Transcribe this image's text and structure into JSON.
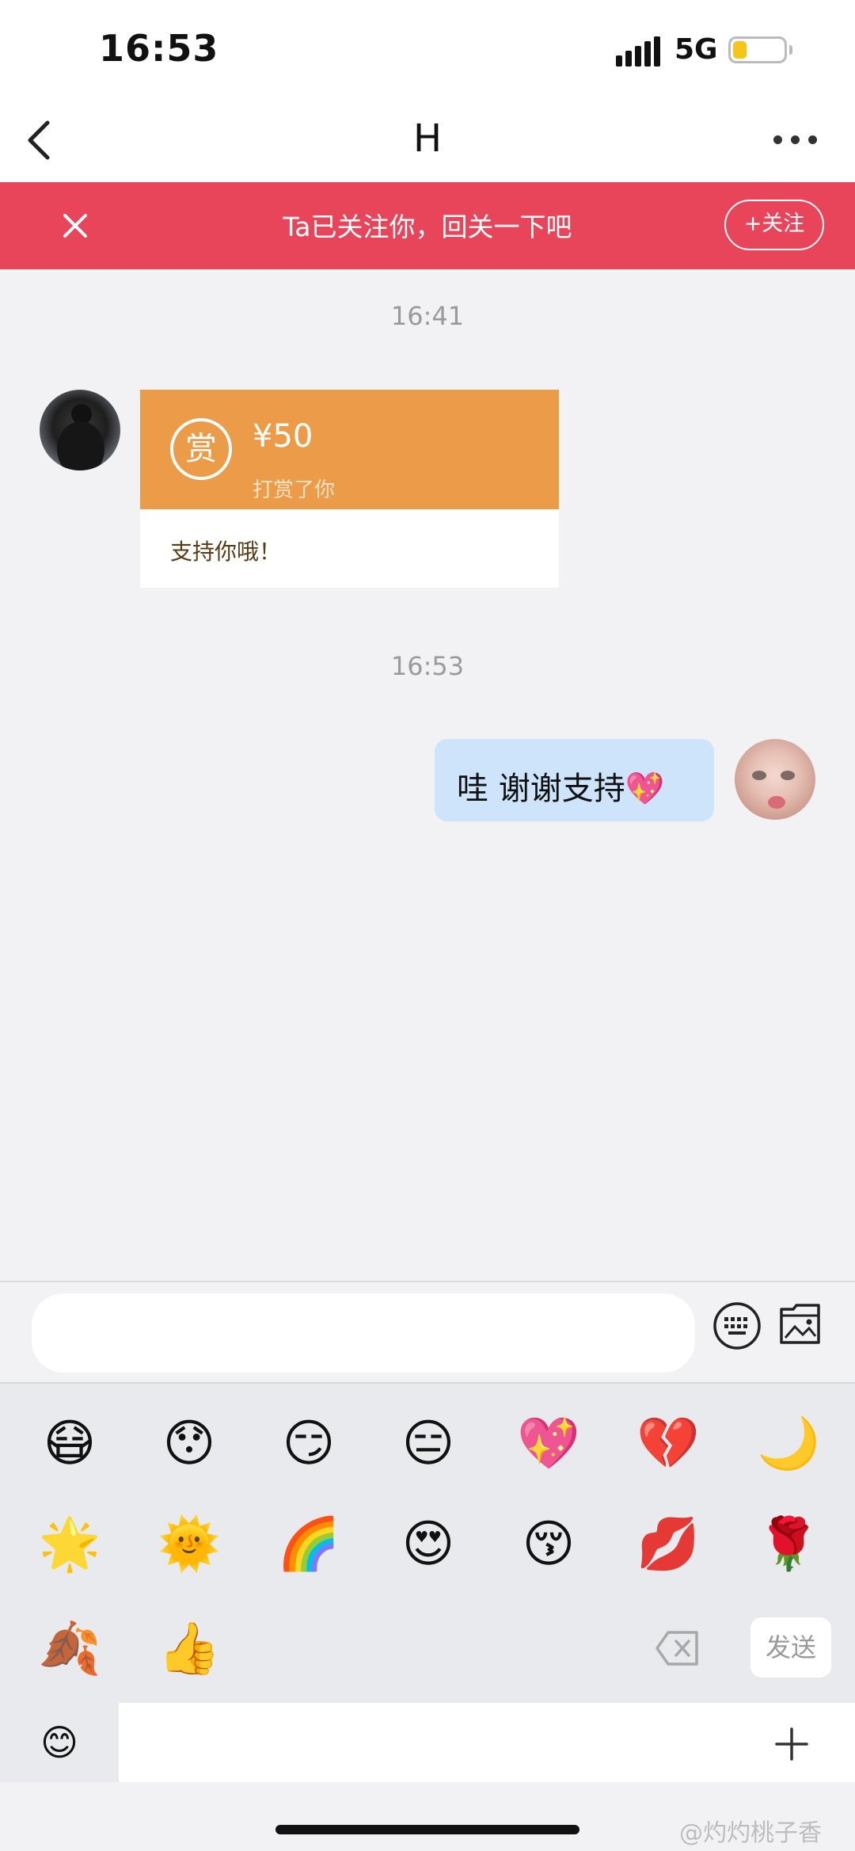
{
  "status_bar": {
    "time": "16:53",
    "network": "5G",
    "battery_level": 0.28
  },
  "header": {
    "title": "H",
    "back_icon": "chevron-left-icon",
    "more_icon": "ellipsis-icon"
  },
  "follow_banner": {
    "text": "Ta已关注你，回关一下吧",
    "follow_label": "+关注",
    "background": "#e8445a"
  },
  "messages": {
    "timestamp_1": "16:41",
    "reward": {
      "seal": "赏",
      "amount": "¥50",
      "subtitle": "打赏了你",
      "message": "支持你哦！",
      "color": "#ec9c48"
    },
    "timestamp_2": "16:53",
    "reply": {
      "text": "哇 谢谢支持💖",
      "bubble_color": "#cde4fb"
    }
  },
  "input": {
    "placeholder": "",
    "value": ""
  },
  "emoji_panel": {
    "emojis": [
      "😷",
      "😯",
      "😏",
      "😑",
      "💖",
      "💔",
      "🌙",
      "🌟",
      "🌞",
      "🌈",
      "😍",
      "😚",
      "💋",
      "🌹",
      "🍂",
      "👍"
    ],
    "send_label": "发送",
    "delete_icon": "backspace-icon"
  },
  "bottom_tabs": {
    "emoji_tab": "😊",
    "plus_icon": "plus-icon"
  },
  "watermark": "@灼灼桃子香"
}
